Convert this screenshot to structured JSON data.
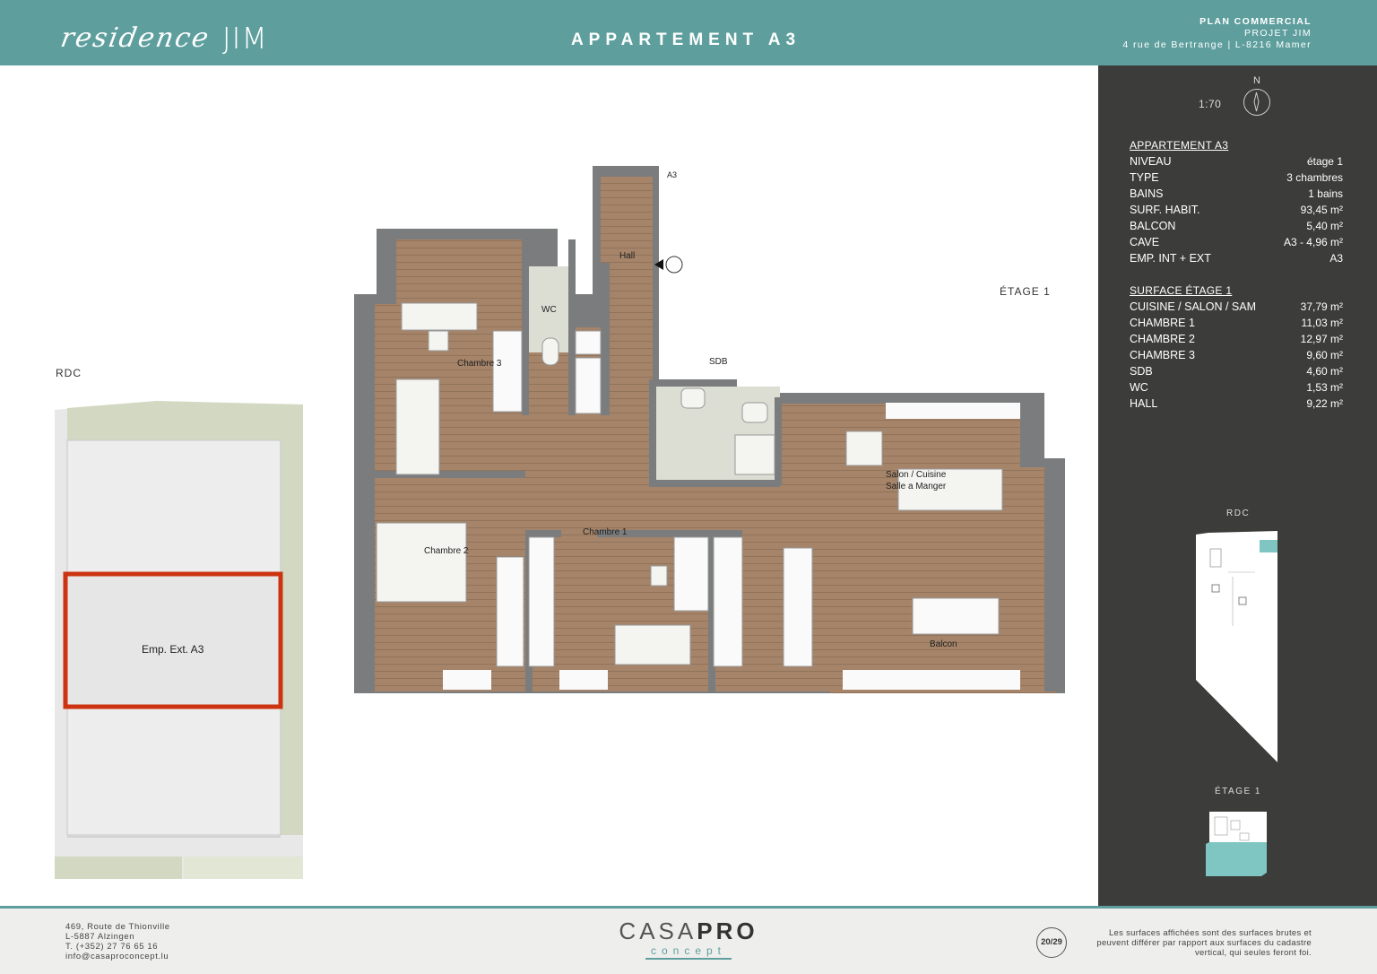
{
  "header": {
    "logo_script": "residence",
    "logo_mark": "JIM",
    "title": "APPARTEMENT A3",
    "right_line1": "PLAN COMMERCIAL",
    "right_line2": "PROJET JIM",
    "right_line3": "4 rue de Bertrange | L-8216 Mamer"
  },
  "plan": {
    "floor_label": "ÉTAGE 1",
    "rdc_label": "RDC",
    "ext_label": "Emp. Ext. A3",
    "entry_tag": "A3",
    "rooms": {
      "chambre3": "Chambre 3",
      "wc": "WC",
      "hall": "Hall",
      "sdb": "SDB",
      "chambre2": "Chambre 2",
      "chambre1": "Chambre 1",
      "salon_line1": "Salon / Cuisine",
      "salon_line2": "Salle a Manger",
      "balcon": "Balcon"
    },
    "colors": {
      "wood": "#a58469",
      "wall": "#7a7c7d",
      "tile": "#dcddd3",
      "teal": "#5e9f9e",
      "highlight": "#cc3310"
    }
  },
  "side": {
    "north": "N",
    "scale": "1:70",
    "apt_heading": "APPARTEMENT A3",
    "apt_rows": [
      {
        "k": "NIVEAU",
        "v": "étage 1"
      },
      {
        "k": "TYPE",
        "v": "3 chambres"
      },
      {
        "k": "BAINS",
        "v": "1 bains"
      },
      {
        "k": "SURF. HABIT.",
        "v": "93,45 m²"
      },
      {
        "k": "BALCON",
        "v": "5,40 m²"
      },
      {
        "k": "CAVE",
        "v": "A3 - 4,96 m²"
      },
      {
        "k": "EMP. INT + EXT",
        "v": "A3"
      }
    ],
    "surf_heading": "SURFACE ÉTAGE 1",
    "surf_rows": [
      {
        "k": "CUISINE / SALON / SAM",
        "v": "37,79 m²"
      },
      {
        "k": "CHAMBRE 1",
        "v": "11,03 m²"
      },
      {
        "k": "CHAMBRE 2",
        "v": "12,97 m²"
      },
      {
        "k": "CHAMBRE 3",
        "v": "9,60 m²"
      },
      {
        "k": "SDB",
        "v": "4,60 m²"
      },
      {
        "k": "WC",
        "v": "1,53 m²"
      },
      {
        "k": "HALL",
        "v": "9,22 m²"
      }
    ],
    "mini_rdc": "RDC",
    "mini_etage": "ÉTAGE 1"
  },
  "footer": {
    "addr1": "469, Route de Thionville",
    "addr2": "L-5887 Alzingen",
    "addr3": "T. (+352) 27 76 65 16",
    "addr4": "info@casaproconcept.lu",
    "brand_a": "CASA",
    "brand_b": "PRO",
    "brand_sub": "concept",
    "page": "20/29",
    "note": "Les surfaces affichées sont des surfaces brutes et peuvent différer par rapport aux surfaces du cadastre vertical, qui seules feront foi."
  }
}
